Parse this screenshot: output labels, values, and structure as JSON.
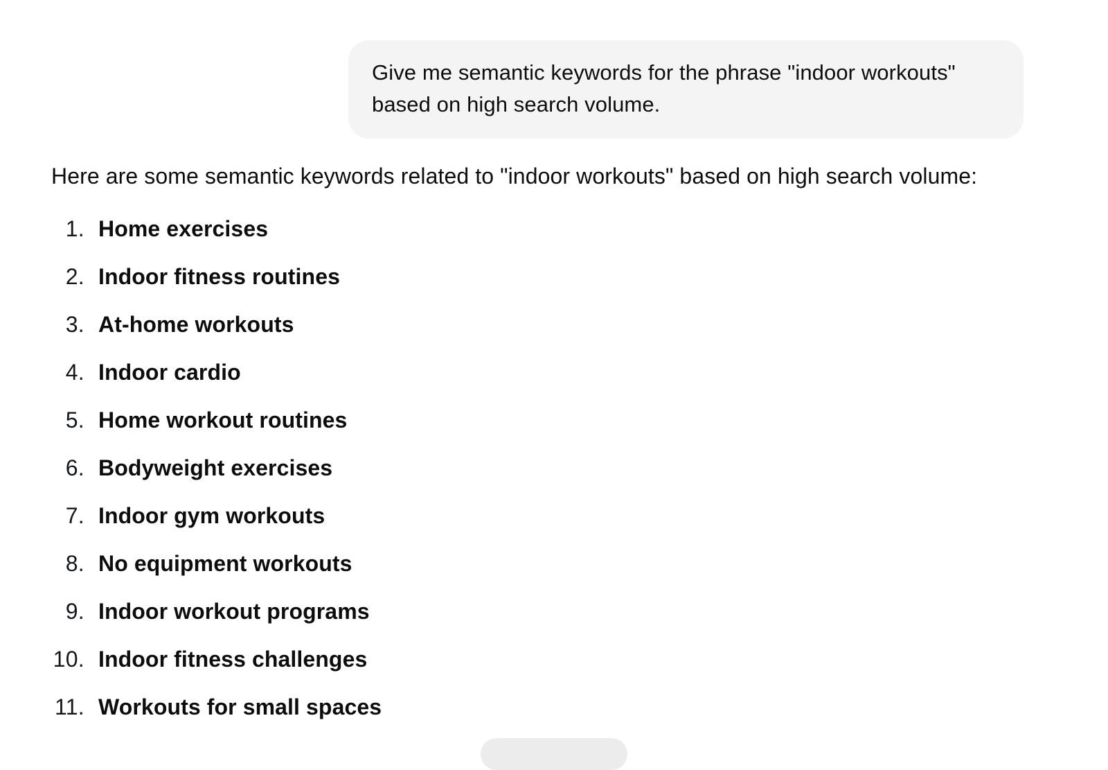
{
  "conversation": {
    "user_message": {
      "text": "Give me semantic keywords for the phrase \"indoor workouts\" based on high search volume.",
      "bubble_color": "#f4f4f4"
    },
    "assistant_message": {
      "intro": "Here are some semantic keywords related to \"indoor workouts\" based on high search volume:",
      "list": [
        {
          "number": "1.",
          "label": "Home exercises"
        },
        {
          "number": "2.",
          "label": "Indoor fitness routines"
        },
        {
          "number": "3.",
          "label": "At-home workouts"
        },
        {
          "number": "4.",
          "label": "Indoor cardio"
        },
        {
          "number": "5.",
          "label": "Home workout routines"
        },
        {
          "number": "6.",
          "label": "Bodyweight exercises"
        },
        {
          "number": "7.",
          "label": "Indoor gym workouts"
        },
        {
          "number": "8.",
          "label": "No equipment workouts"
        },
        {
          "number": "9.",
          "label": "Indoor workout programs"
        },
        {
          "number": "10.",
          "label": "Indoor fitness challenges"
        },
        {
          "number": "11.",
          "label": "Workouts for small spaces"
        }
      ]
    }
  },
  "theme": {
    "background": "#ffffff",
    "text_color": "#0d0d0d",
    "bubble_background": "#f4f4f4",
    "number_color": "#15171a"
  }
}
